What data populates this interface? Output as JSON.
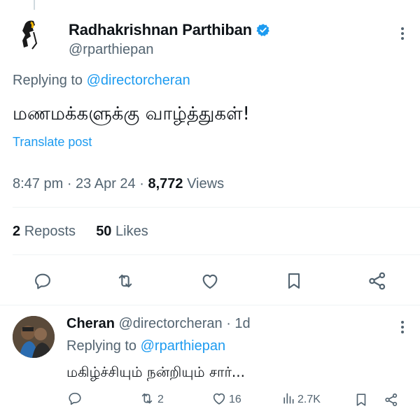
{
  "tweet": {
    "author_name": "Radhakrishnan Parthiban",
    "author_handle": "@rparthiepan",
    "replying_prefix": "Replying to",
    "replying_handle": "@directorcheran",
    "text": "மணமக்களுக்கு வாழ்த்துகள்!",
    "translate_label": "Translate post",
    "time": "8:47 pm",
    "date": "23 Apr 24",
    "views_count": "8,772",
    "views_label": "Views",
    "reposts_count": "2",
    "reposts_label": "Reposts",
    "likes_count": "50",
    "likes_label": "Likes",
    "icons": [
      "reply-icon",
      "repost-icon",
      "like-icon",
      "bookmark-icon",
      "share-icon"
    ]
  },
  "reply": {
    "author_name": "Cheran",
    "author_handle": "@directorcheran",
    "age": "1d",
    "replying_prefix": "Replying to",
    "replying_handle": "@rparthiepan",
    "text": "மகிழ்ச்சியும் நன்றியும் சார்...",
    "reposts": "2",
    "likes": "16",
    "views": "2.7K"
  },
  "colors": {
    "accent": "#1d9bf0",
    "secondary_text": "#536471",
    "primary_text": "#0f1419",
    "divider": "#eff3f4"
  }
}
